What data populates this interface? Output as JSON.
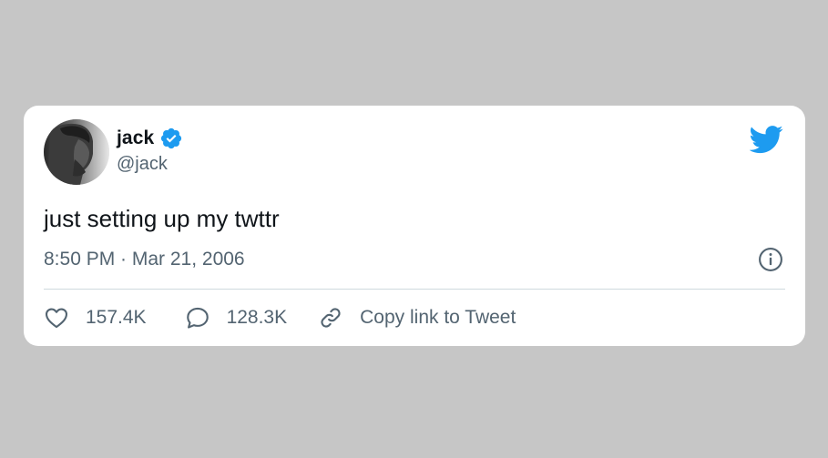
{
  "tweet": {
    "author": {
      "display_name": "jack",
      "handle": "@jack",
      "verified": true,
      "avatar_icon": "profile-photo"
    },
    "text": "just setting up my twttr",
    "timestamp": "8:50 PM · Mar 21, 2006",
    "likes": "157.4K",
    "replies": "128.3K",
    "copy_link_label": "Copy link to Tweet",
    "brand_icon": "twitter-bird-icon",
    "info_icon": "info-icon"
  },
  "colors": {
    "background": "#c6c6c6",
    "card": "#ffffff",
    "brand_blue": "#1d9bf0",
    "text_primary": "#0f1419",
    "text_secondary": "#536471",
    "divider": "#cfd9de"
  }
}
